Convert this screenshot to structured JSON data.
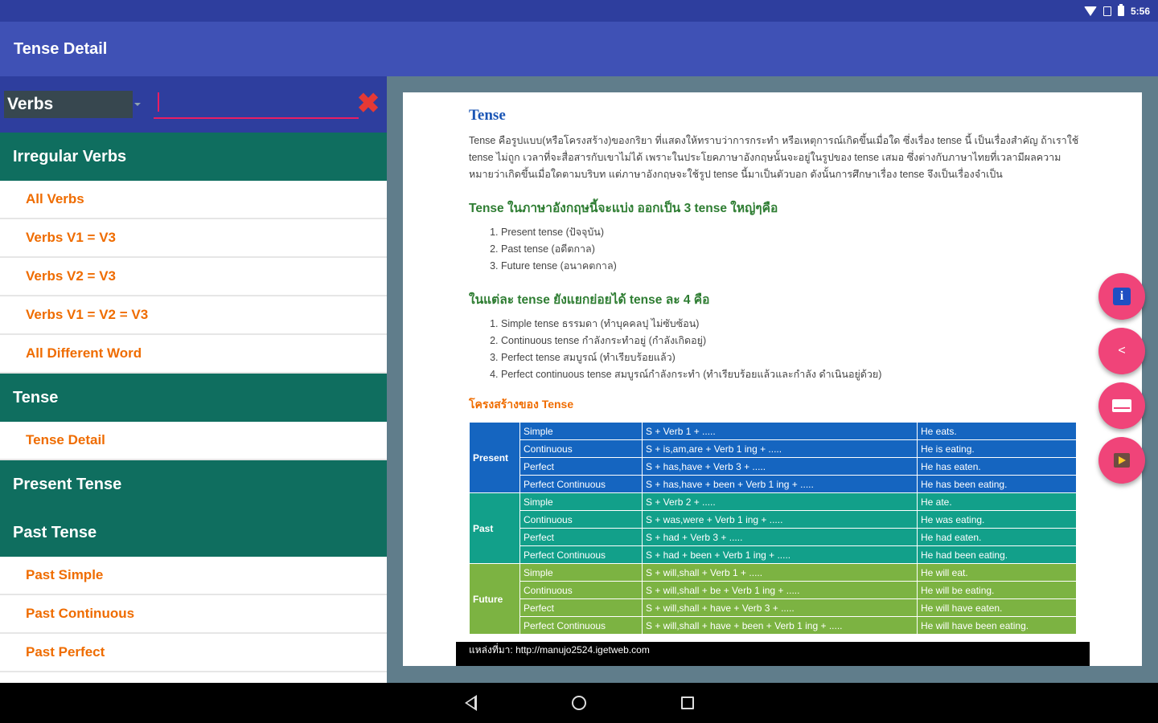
{
  "status_bar": {
    "time": "5:56"
  },
  "app_bar": {
    "title": "Tense Detail"
  },
  "sidebar": {
    "spinner_value": "Verbs",
    "search": {
      "value": "",
      "placeholder": ""
    },
    "clear_symbol": "✖",
    "sections": [
      {
        "header": "Irregular Verbs",
        "items": [
          "All Verbs",
          "Verbs V1 = V3",
          "Verbs V2 = V3",
          "Verbs V1 = V2 = V3",
          "All Different Word"
        ]
      },
      {
        "header": "Tense",
        "items": [
          "Tense Detail"
        ]
      },
      {
        "header": "Present Tense",
        "items": []
      },
      {
        "header": "Past Tense",
        "items": [
          "Past Simple",
          "Past Continuous",
          "Past Perfect"
        ]
      }
    ]
  },
  "doc": {
    "title": "Tense",
    "intro": "Tense คือรูปแบบ(หรือโครงสร้าง)ของกริยา ที่แสดงให้ทราบว่าการกระทำ หรือเหตุการณ์เกิดขึ้นเมื่อใด ซึ่งเรื่อง tense นี้ เป็นเรื่องสำคัญ ถ้าเราใช้ tense ไม่ถูก เวลาที่จะสื่อสารกับเขาไม่ได้ เพราะในประโยคภาษาอังกฤษนั้นจะอยู่ในรูปของ tense เสมอ ซึ่งต่างกับภาษาไทยที่เวลามีผลความหมายว่าเกิดขึ้นเมื่อใดตามบริบท แต่ภาษาอังกฤษจะใช้รูป tense นี้มาเป็นตัวบอก ดังนั้นการศึกษาเรื่อง tense จึงเป็นเรื่องจำเป็น",
    "heading1": "Tense ในภาษาอังกฤษนี้จะแบ่ง ออกเป็น 3 tense ใหญ่ๆคือ",
    "list1": [
      "Present tense (ปัจจุบัน)",
      "Past tense (อดีตกาล)",
      "Future tense (อนาคตกาล)"
    ],
    "heading2": "ในแต่ละ tense ยังแยกย่อยได้ tense ละ 4 คือ",
    "list2": [
      "Simple tense ธรรมดา (ทำบุคคลปุ ไม่ซับซ้อน)",
      "Continuous tense กำลังกระทำอยู่ (กำลังเกิดอยู่)",
      "Perfect tense สมบูรณ์ (ทำเรียบร้อยแล้ว)",
      "Perfect continuous tense สมบูรณ์กำลังกระทำ (ทำเรียบร้อยแล้วและกำลัง ดำเนินอยู่ด้วย)"
    ],
    "heading3": "โครงสร้างของ Tense",
    "table": {
      "groups": [
        {
          "name": "Present",
          "rows": [
            [
              "Simple",
              "S + Verb 1 + .....",
              "He eats."
            ],
            [
              "Continuous",
              "S + is,am,are + Verb 1 ing + .....",
              "He is eating."
            ],
            [
              "Perfect",
              "S + has,have + Verb 3 + .....",
              "He has eaten."
            ],
            [
              "Perfect Continuous",
              "S + has,have + been + Verb 1 ing + .....",
              "He has been eating."
            ]
          ]
        },
        {
          "name": "Past",
          "rows": [
            [
              "Simple",
              "S + Verb 2 + .....",
              "He ate."
            ],
            [
              "Continuous",
              "S + was,were + Verb 1 ing + .....",
              "He was eating."
            ],
            [
              "Perfect",
              "S + had + Verb 3 + .....",
              "He had eaten."
            ],
            [
              "Perfect Continuous",
              "S + had + been + Verb 1 ing + .....",
              "He had been eating."
            ]
          ]
        },
        {
          "name": "Future",
          "rows": [
            [
              "Simple",
              "S + will,shall + Verb 1 + .....",
              "He will eat."
            ],
            [
              "Continuous",
              "S + will,shall + be + Verb 1 ing + .....",
              "He will be eating."
            ],
            [
              "Perfect",
              "S + will,shall + have + Verb 3 + .....",
              "He will have eaten."
            ],
            [
              "Perfect Continuous",
              "S + will,shall + have + been + Verb 1 ing + .....",
              "He will have been eating."
            ]
          ]
        }
      ]
    },
    "source_url": "แหล่งที่มา: http://manujo2524.igetweb.com"
  },
  "fabs": [
    {
      "icon": "info-icon",
      "glyph": "i"
    },
    {
      "icon": "share-icon",
      "glyph": "<"
    },
    {
      "icon": "mail-icon",
      "glyph": ""
    },
    {
      "icon": "video-icon",
      "glyph": ""
    }
  ],
  "colors": {
    "app_bar": "#3f51b5",
    "status_bar": "#2e3e9e",
    "section_header": "#0f6e5f",
    "list_text": "#ef6c00",
    "fab": "#f04479",
    "present_row": "#1565c0",
    "past_row": "#12a08a",
    "future_row": "#7cb342"
  }
}
